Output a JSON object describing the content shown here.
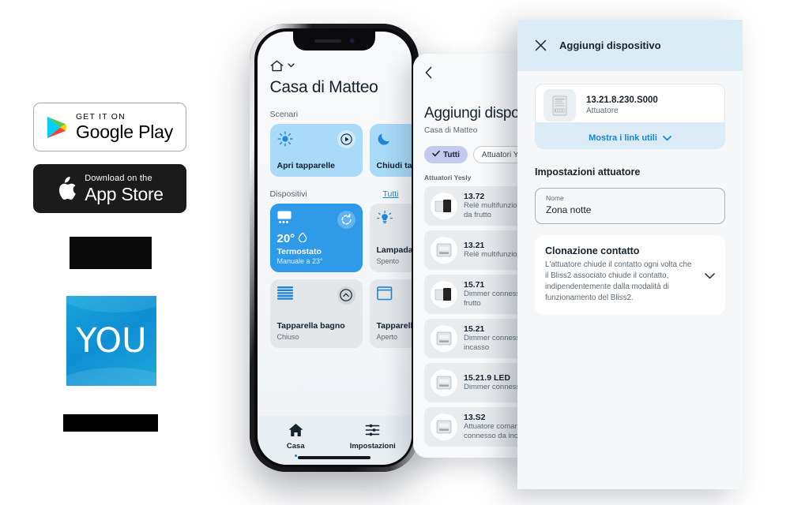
{
  "store_badges": {
    "google_play": {
      "small": "GET IT ON",
      "big": "Google Play",
      "icon": "google-play-triangle-icon"
    },
    "app_store": {
      "small": "Download on the",
      "big": "App Store",
      "icon": "apple-logo-icon"
    }
  },
  "brand": {
    "logo_text": "YOU",
    "logo_colors": {
      "start": "#16a5dd",
      "end": "#0e8fd4"
    },
    "redacted_top": "",
    "redacted_bottom": ""
  },
  "phone": {
    "home": {
      "house_chip_icon": "house-outline-icon",
      "house_chip_caret": "chevron-down-icon",
      "title": "Casa di Matteo",
      "scenari_label": "Scenari",
      "scenari": [
        {
          "name": "Apri tapparelle",
          "icon": "sun-icon",
          "action_icon": "play-circle-icon",
          "color": "#a9daf7"
        },
        {
          "name": "Chiudi tapparelle",
          "icon": "moon-icon",
          "action_icon": "",
          "color": "#a9daf7"
        }
      ],
      "dispositivi_label": "Dispositivi",
      "dispositivi_link": "Tutti",
      "devices": [
        {
          "name": "Termostato",
          "sub": "Manuale a 23°",
          "value": "20°",
          "icon": "thermostat-icon",
          "badge_icon": "flame-icon",
          "action_icon": "refresh-icon",
          "active": true
        },
        {
          "name": "Tapparella bagno",
          "sub": "Chiuso",
          "value": "",
          "icon": "shutter-closed-icon",
          "action_icon": "chevron-up-circle-icon",
          "active": false
        },
        {
          "name": "Lampada",
          "sub": "Spento",
          "value": "",
          "icon": "bulb-icon",
          "action_icon": "",
          "active": false
        },
        {
          "name": "Tapparella",
          "sub": "Aperto",
          "value": "",
          "icon": "shutter-open-icon",
          "action_icon": "",
          "active": false
        }
      ],
      "tabs": [
        {
          "label": "Casa",
          "icon": "home-filled-icon",
          "active": true
        },
        {
          "label": "Impostazioni",
          "icon": "sliders-icon",
          "active": false
        }
      ]
    }
  },
  "middle_sheet": {
    "back_icon": "chevron-left-icon",
    "title": "Aggiungi dispositivo",
    "subtitle": "Casa di Matteo",
    "filters": [
      {
        "label": "Tutti",
        "selected": true,
        "icon": "check-icon"
      },
      {
        "label": "Attuatori Yesly",
        "selected": false,
        "icon": ""
      }
    ],
    "group_label": "Attuatori Yesly",
    "devices": [
      {
        "code": "13.72",
        "desc_1": "Relè multifunzione",
        "desc_2": "da frutto",
        "icon": "module-black-icon"
      },
      {
        "code": "13.21",
        "desc_1": "Relè multifunzione",
        "desc_2": "",
        "icon": "module-grey-icon"
      },
      {
        "code": "15.71",
        "desc_1": "Dimmer connesso",
        "desc_2": "frutto",
        "icon": "module-black-icon"
      },
      {
        "code": "15.21",
        "desc_1": "Dimmer connesso",
        "desc_2": "incasso",
        "icon": "module-grey-icon"
      },
      {
        "code": "15.21.9 LED",
        "desc_1": "Dimmer connesso",
        "desc_2": "",
        "icon": "module-grey-icon"
      },
      {
        "code": "13.S2",
        "desc_1": "Attuatore comandato",
        "desc_2": "connesso da incasso",
        "icon": "module-grey-icon"
      }
    ]
  },
  "right_sheet": {
    "header": {
      "close_icon": "close-x-icon",
      "title": "Aggiungi dispositivo",
      "bg": "#dcecf7"
    },
    "device": {
      "code": "13.21.8.230.S000",
      "type": "Attuatore",
      "icon": "module-module-icon"
    },
    "links_toggle": {
      "label": "Mostra i link utili",
      "icon": "chevron-down-icon",
      "color": "#1686d8"
    },
    "settings_title": "Impostazioni attuatore",
    "name_field": {
      "label": "Nome",
      "value": "Zona notte",
      "placeholder": "Nome"
    },
    "accordion": {
      "title": "Clonazione contatto",
      "description": "L'attuatore chiude il contatto ogni volta che il Bliss2 associato chiude il contatto, indipendentemente dalla modalità di funzionamento del Bliss2.",
      "icon": "chevron-down-icon"
    }
  }
}
